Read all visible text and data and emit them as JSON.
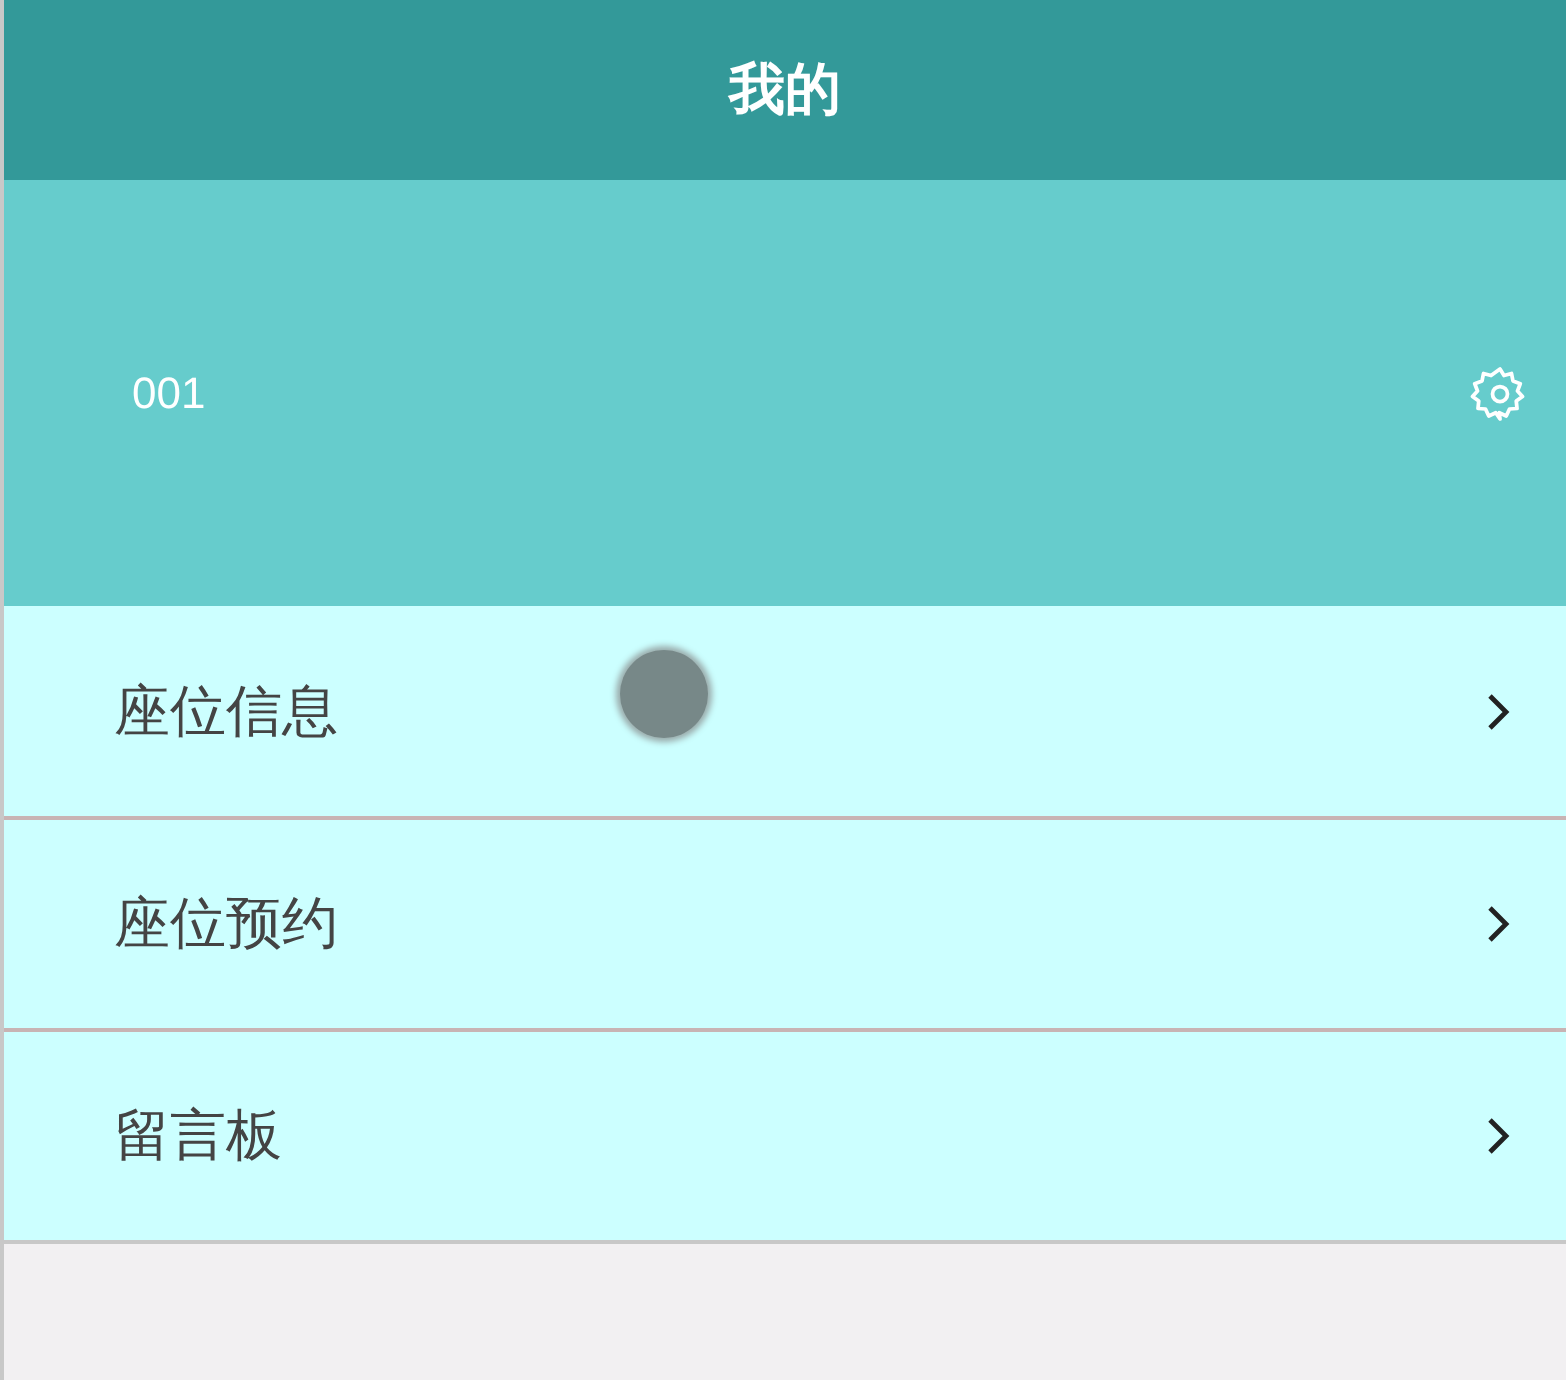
{
  "header": {
    "title": "我的"
  },
  "profile": {
    "user_id": "001"
  },
  "menu": [
    {
      "label": "座位信息"
    },
    {
      "label": "座位预约"
    },
    {
      "label": "留言板"
    }
  ]
}
